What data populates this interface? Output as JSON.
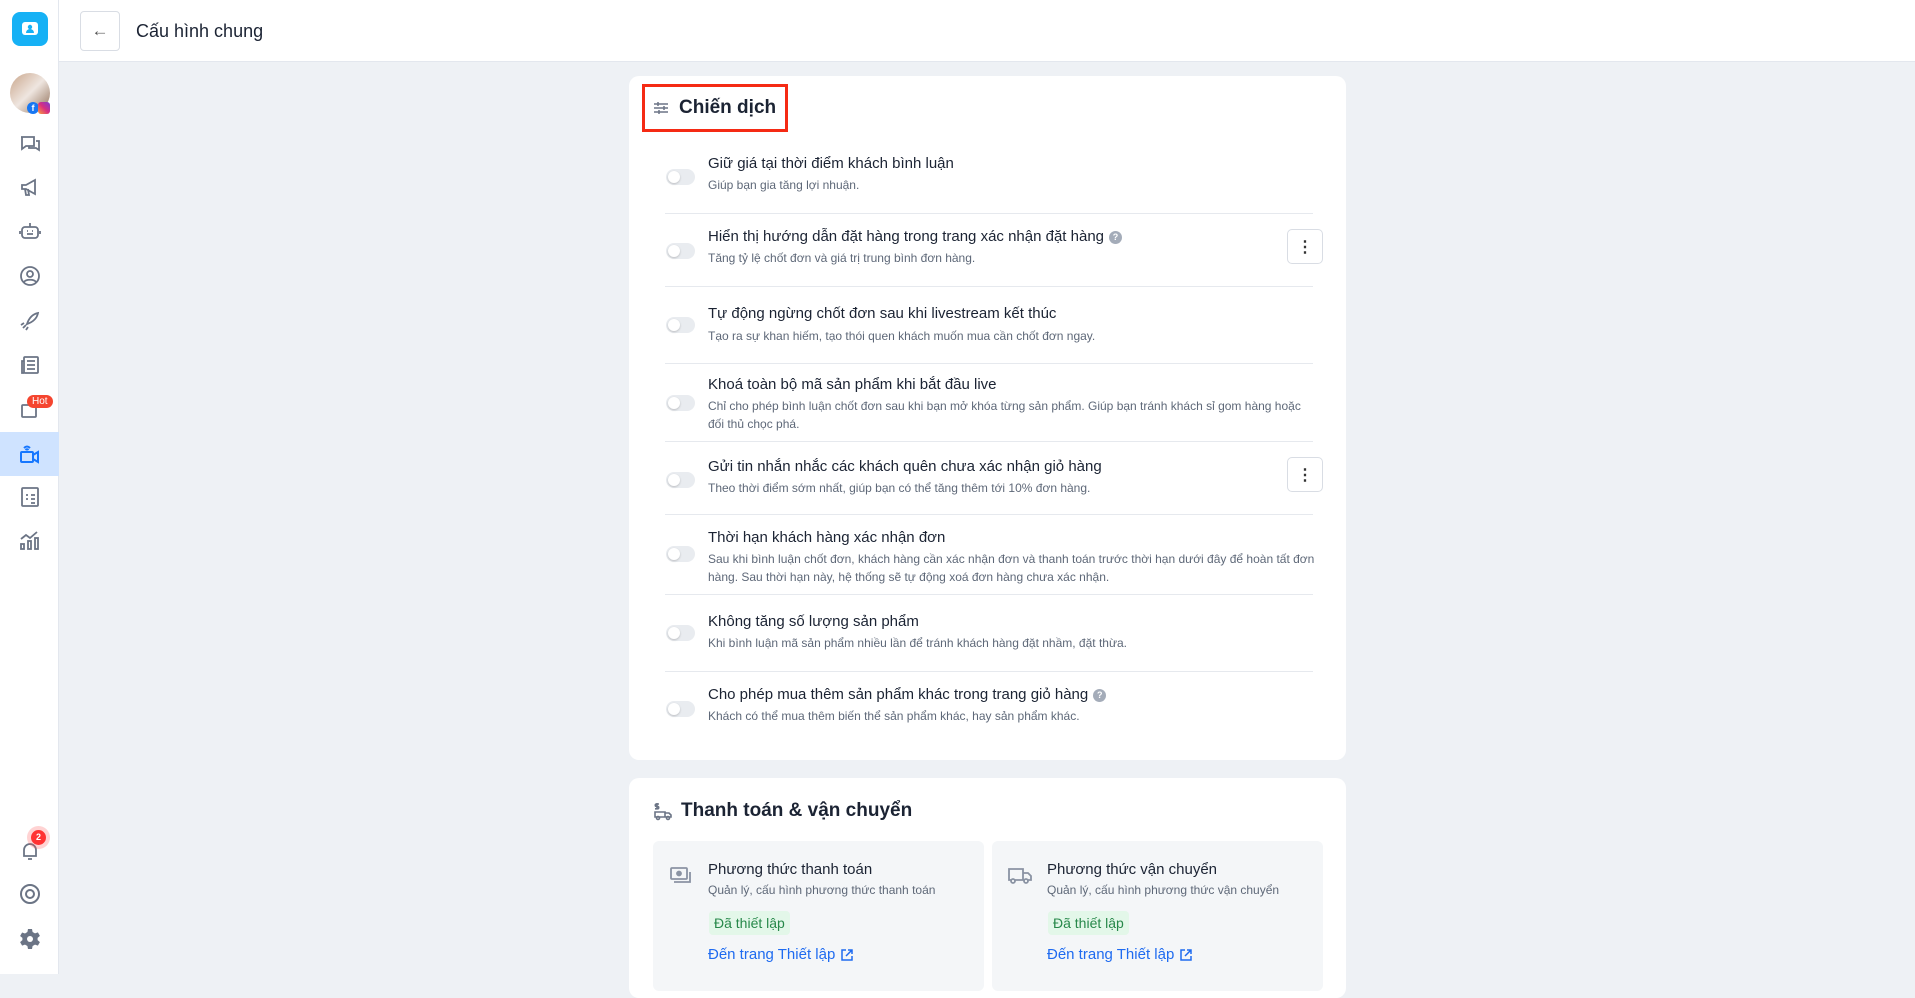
{
  "header": {
    "title": "Cấu hình chung"
  },
  "sidebar": {
    "hot_badge": "Hot",
    "notification_count": "2"
  },
  "campaign": {
    "title": "Chiến dịch",
    "items": [
      {
        "title": "Giữ giá tại thời điểm khách bình luận",
        "desc": "Giúp bạn gia tăng lợi nhuận.",
        "enabled": false
      },
      {
        "title": "Hiển thị hướng dẫn đặt hàng trong trang xác nhận đặt hàng",
        "desc": "Tăng tỷ lệ chốt đơn và giá trị trung bình đơn hàng.",
        "enabled": false
      },
      {
        "title": "Tự động ngừng chốt đơn sau khi livestream kết thúc",
        "desc": "Tạo ra sự khan hiếm, tạo thói quen khách muốn mua cần chốt đơn ngay.",
        "enabled": false
      },
      {
        "title": "Khoá toàn bộ mã sản phẩm khi bắt đầu live",
        "desc": "Chỉ cho phép bình luận chốt đơn sau khi bạn mở khóa từng sản phẩm. Giúp bạn tránh khách sỉ gom hàng hoặc đối thủ chọc phá.",
        "enabled": false
      },
      {
        "title": "Gửi tin nhắn nhắc các khách quên chưa xác nhận giỏ hàng",
        "desc": "Theo thời điểm sớm nhất, giúp bạn có thể tăng thêm tới 10% đơn hàng.",
        "enabled": false
      },
      {
        "title": "Thời hạn khách hàng xác nhận đơn",
        "desc": "Sau khi bình luận chốt đơn, khách hàng cần xác nhận đơn và thanh toán trước thời hạn dưới đây để hoàn tất đơn hàng. Sau thời hạn này, hệ thống sẽ tự động xoá đơn hàng chưa xác nhận.",
        "enabled": false
      },
      {
        "title": "Không tăng số lượng sản phẩm",
        "desc": "Khi bình luận mã sản phẩm nhiều lần để tránh khách hàng đặt nhầm, đặt thừa.",
        "enabled": false
      },
      {
        "title": "Cho phép mua thêm sản phẩm khác trong trang giỏ hàng",
        "desc": "Khách có thể mua thêm biến thể sản phẩm khác, hay sản phẩm khác.",
        "enabled": false
      }
    ]
  },
  "payment": {
    "title": "Thanh toán & vận chuyển",
    "cards": [
      {
        "title": "Phương thức thanh toán",
        "desc": "Quản lý, cấu hình phương thức thanh toán",
        "status": "Đã thiết lập",
        "link": "Đến trang Thiết lập"
      },
      {
        "title": "Phương thức vận chuyển",
        "desc": "Quản lý, cấu hình phương thức vận chuyển",
        "status": "Đã thiết lập",
        "link": "Đến trang Thiết lập"
      }
    ]
  }
}
